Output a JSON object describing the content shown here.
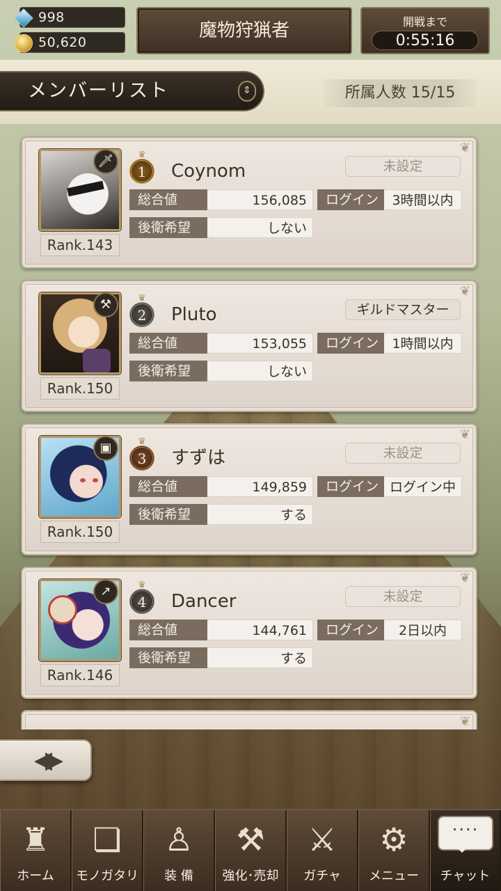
{
  "resources": {
    "gems": "998",
    "gold": "50,620"
  },
  "guild": {
    "name": "魔物狩猟者"
  },
  "battle": {
    "label": "開戦まで",
    "timer": "0:55:16"
  },
  "header": {
    "title": "メンバーリスト",
    "member_count": "所属人数 15/15"
  },
  "labels": {
    "total": "総合値",
    "login": "ログイン",
    "rear": "後衛希望"
  },
  "members": [
    {
      "place": "1",
      "name": "Coynom",
      "role": "未設定",
      "total": "156,085",
      "login": "3時間以内",
      "rear": "しない",
      "rank": "Rank.143"
    },
    {
      "place": "2",
      "name": "Pluto",
      "role": "ギルドマスター",
      "total": "153,055",
      "login": "1時間以内",
      "rear": "しない",
      "rank": "Rank.150"
    },
    {
      "place": "3",
      "name": "すずは",
      "role": "未設定",
      "total": "149,859",
      "login": "ログイン中",
      "rear": "する",
      "rank": "Rank.150"
    },
    {
      "place": "4",
      "name": "Dancer",
      "role": "未設定",
      "total": "144,761",
      "login": "2日以内",
      "rear": "する",
      "rank": "Rank.146"
    }
  ],
  "nav": {
    "home": "ホーム",
    "story": "モノガタリ",
    "equip": "装 備",
    "enhance": "強化･売却",
    "gacha": "ガチャ",
    "menu": "メニュー",
    "chat": "チャット",
    "chat_bubble": "····"
  },
  "icons": {
    "nav": [
      "castle-icon",
      "book-icon",
      "puppet-icon",
      "anvil-icon",
      "crossed-swords-icon",
      "gears-icon",
      "chat-bubble-icon"
    ],
    "weapons": [
      "sword-icon",
      "hammer-icon",
      "tome-icon",
      "spear-icon"
    ]
  }
}
